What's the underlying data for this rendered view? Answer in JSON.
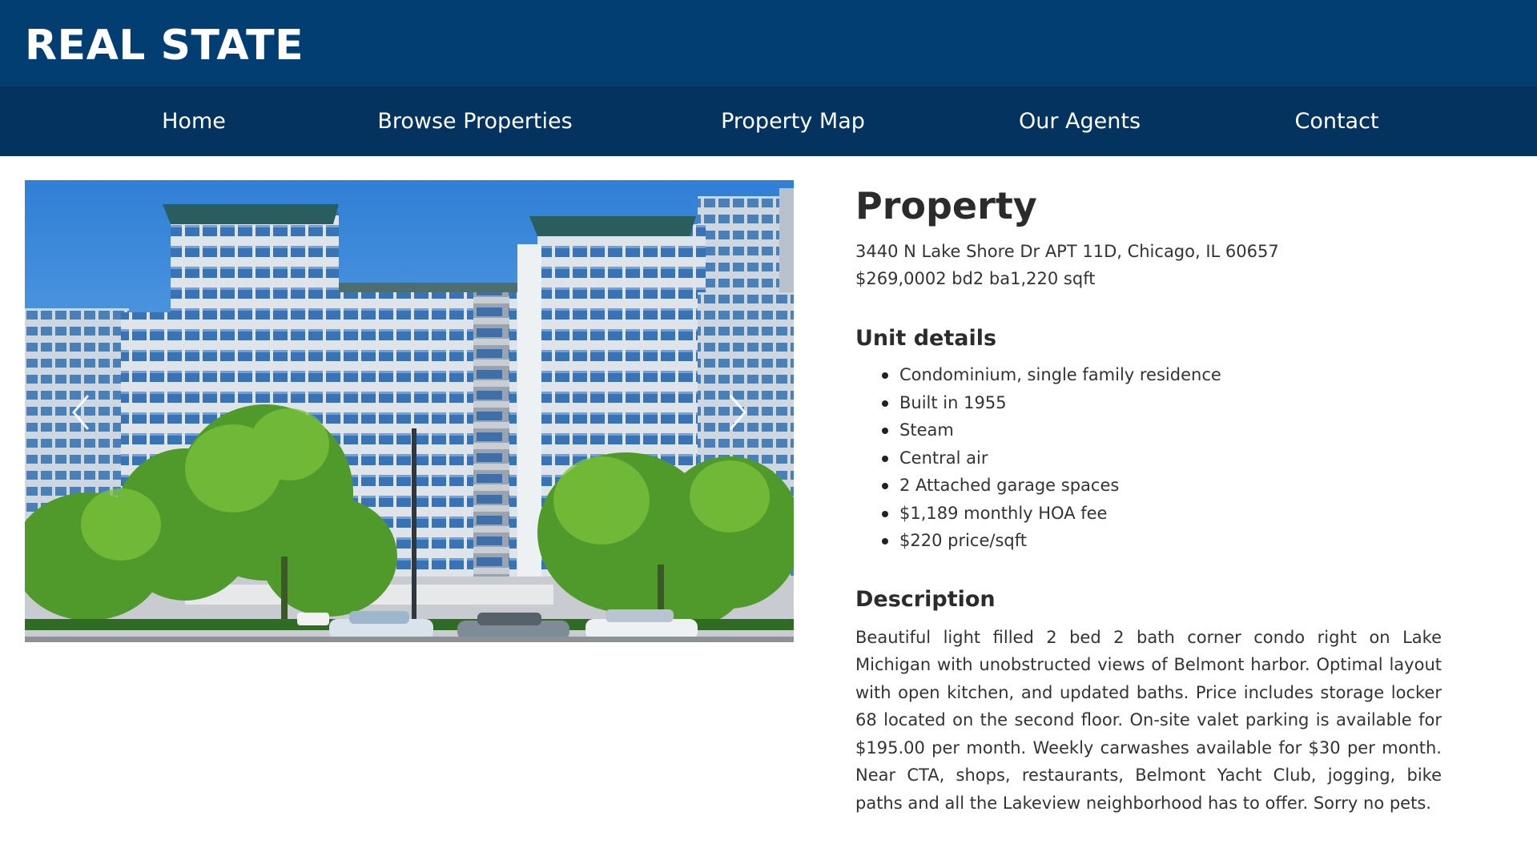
{
  "header": {
    "brand": "REAL STATE"
  },
  "nav": {
    "items": [
      {
        "label": "Home"
      },
      {
        "label": "Browse Properties"
      },
      {
        "label": "Property Map"
      },
      {
        "label": "Our Agents"
      },
      {
        "label": "Contact"
      }
    ]
  },
  "carousel": {
    "image_description": "apartment-building-photo",
    "prev_icon": "chevron-left-icon",
    "next_icon": "chevron-right-icon"
  },
  "property": {
    "title": "Property",
    "address": "3440 N Lake Shore Dr APT 11D, Chicago, IL 60657",
    "summary": "$269,0002 bd2 ba1,220 sqft",
    "unit_details_heading": "Unit details",
    "unit_details": [
      "Condominium, single family residence",
      "Built in 1955",
      "Steam",
      "Central air",
      "2 Attached garage spaces",
      "$1,189 monthly HOA fee",
      "$220 price/sqft"
    ],
    "description_heading": "Description",
    "description": "Beautiful light filled 2 bed 2 bath corner condo right on Lake Michigan with unobstructed views of Belmont harbor. Optimal layout with open kitchen, and updated baths. Price includes storage locker 68 located on the second floor. On-site valet parking is available for $195.00 per month. Weekly carwashes available for $30 per month. Near CTA, shops, restaurants, Belmont Yacht Club, jogging, bike paths and all the Lakeview neighborhood has to offer. Sorry no pets."
  },
  "colors": {
    "header_bg": "#033e72",
    "nav_bg": "#04335f",
    "nav_text": "#ffffff"
  }
}
